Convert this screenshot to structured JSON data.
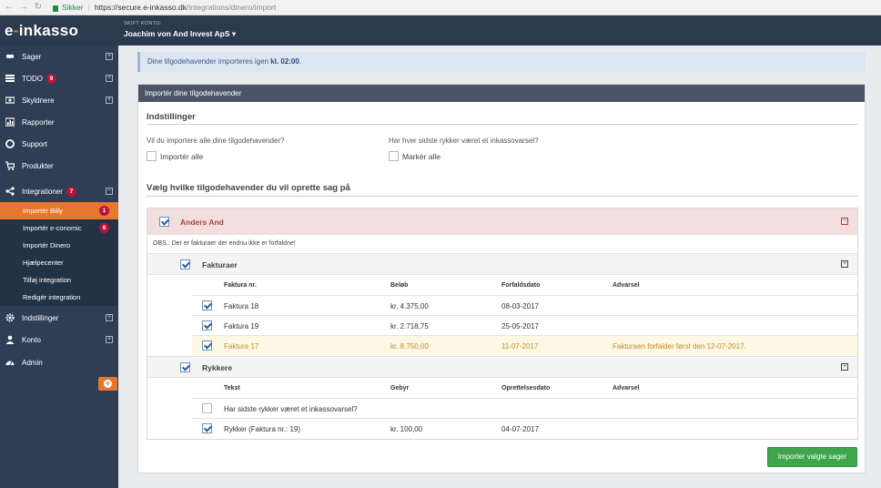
{
  "browser": {
    "secure_label": "Sikker",
    "url_host": "https://secure.e-inkasso.dk",
    "url_path": "/integrations/dinero/import"
  },
  "header": {
    "logo_text_1": "e",
    "logo_dash": "-",
    "logo_text_2": "inkasso",
    "account_label": "SKIFT KONTO:",
    "account_name": "Joachim von And Invest ApS ▾"
  },
  "sidebar": {
    "items": [
      {
        "label": "Sager",
        "icon": "car-icon"
      },
      {
        "label": "TODO",
        "badge": "9",
        "icon": "list-icon"
      },
      {
        "label": "Skyldnere",
        "icon": "money-icon"
      },
      {
        "label": "Rapporter",
        "icon": "chart-icon"
      },
      {
        "label": "Support",
        "icon": "lifebuoy-icon"
      },
      {
        "label": "Produkter",
        "icon": "cart-icon"
      },
      {
        "label": "Integrationer",
        "badge": "7",
        "icon": "share-icon"
      },
      {
        "label": "Indstillinger",
        "icon": "gear-icon"
      },
      {
        "label": "Konto",
        "icon": "user-icon"
      },
      {
        "label": "Admin",
        "icon": "dashboard-icon"
      }
    ],
    "subitems": [
      {
        "label": "Importér Billy",
        "badge": "1"
      },
      {
        "label": "Importér e-conomic",
        "badge": "6"
      },
      {
        "label": "Importér Dinero"
      },
      {
        "label": "Hjælpecenter"
      },
      {
        "label": "Tilføj integration"
      },
      {
        "label": "Redigér integration"
      }
    ],
    "plus_symbol": "+",
    "minus_symbol": "−"
  },
  "alert": {
    "text_prefix": "Dine tilgodehavender importeres igen ",
    "time": "kl. 02:00",
    "suffix": "."
  },
  "panel": {
    "title": "Importér dine tilgodehavender",
    "settings_title": "Indstillinger",
    "q1": "Vil du importere alle dine tilgodehavender?",
    "q1_option": "Importér alle",
    "q2": "Har hver sidste rykker været et inkassovarsel?",
    "q2_option": "Markér alle",
    "choose_title": "Vælg hvilke tilgodehavender du vil oprette sag på"
  },
  "debtor": {
    "name": "Anders And",
    "notice": "OBS.: Der er fakturaer der endnu ikke er forfaldne!",
    "invoices": {
      "group_label": "Fakturaer",
      "columns": [
        "Faktura nr.",
        "Beløb",
        "Forfaldsdato",
        "Advarsel"
      ],
      "rows": [
        {
          "nr": "Faktura 18",
          "amount": "kr. 4.375,00",
          "due": "08-03-2017",
          "warning": ""
        },
        {
          "nr": "Faktura 19",
          "amount": "kr. 2.718,75",
          "due": "25-05-2017",
          "warning": ""
        },
        {
          "nr": "Faktura 17",
          "amount": "kr. 8.750,00",
          "due": "11-07-2017",
          "warning": "Fakturaen forfalder først den 12-07-2017."
        }
      ]
    },
    "reminders": {
      "group_label": "Rykkere",
      "columns": [
        "Tekst",
        "Gebyr",
        "Oprettelsesdato",
        "Advarsel"
      ],
      "rows": [
        {
          "text": "Har sidste rykker været et inkassovarsel?",
          "fee": "",
          "date": "",
          "warning": ""
        },
        {
          "text": "Rykker (Faktura nr.: 19)",
          "fee": "kr. 100,00",
          "date": "04-07-2017",
          "warning": ""
        }
      ]
    }
  },
  "submit_label": "Importer valgte sager",
  "colors": {
    "sidebar": "#2f3e54",
    "accent": "#e8772e",
    "badge": "#b8143a",
    "success": "#3fa54a"
  }
}
